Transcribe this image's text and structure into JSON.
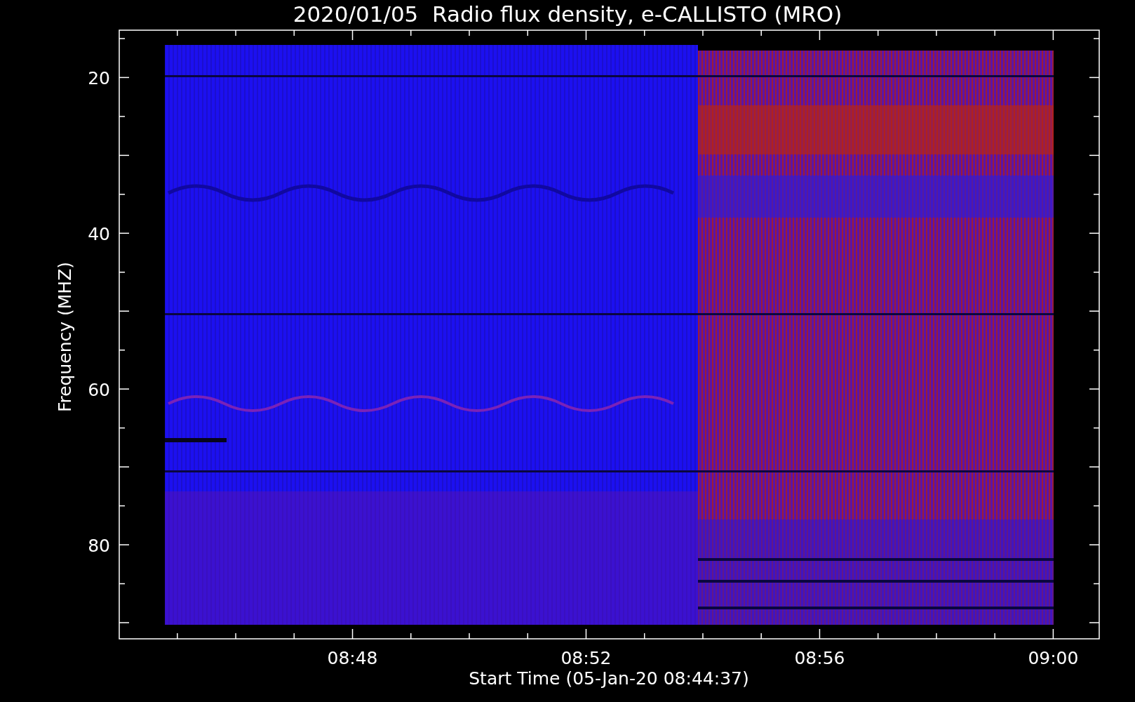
{
  "chart": {
    "title": "2020/01/05  Radio flux density, e-CALLISTO (MRO)",
    "ylabel": "Frequency (MHZ)",
    "ytick_labels": [
      "20",
      "40",
      "60",
      "80"
    ],
    "xtick_labels": [
      "08:48",
      "08:52",
      "08:56",
      "09:00"
    ],
    "xlabel": "Start Time (05-Jan-20 08:44:37)"
  }
}
